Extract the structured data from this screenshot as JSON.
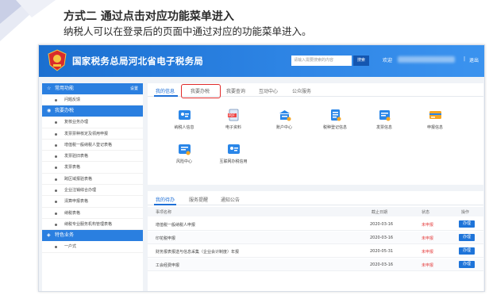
{
  "slide": {
    "title": "方式二 通过点击对应功能菜单进入",
    "subtitle": "纳税人可以在登录后的页面中通过对应的功能菜单进入。"
  },
  "header": {
    "site_title": "国家税务总局河北省电子税务局",
    "search_placeholder": "请输入需要搜索的内容",
    "search_button": "搜索",
    "welcome": "欢迎",
    "separator": "|",
    "logout": "退出"
  },
  "sidebar": {
    "common_title": "常用功能",
    "common_more": "设置",
    "common_items": [
      "问题反馈"
    ],
    "tax_title": "我要办税",
    "tax_items": [
      "复核业务办理",
      "发票票种核定及领用申报",
      "增值税一般纳税人登记表格",
      "发票验旧表格",
      "发票表格",
      "跨区域报验表格",
      "企业注销综合办理",
      "清算申报表格",
      "纳税表格",
      "纳税专业服务机构管理表格"
    ],
    "feature_title": "特色业务",
    "feature_items": [
      "一户式"
    ]
  },
  "main": {
    "tabs": [
      "我的信息",
      "我要办税",
      "我要查询",
      "互动中心",
      "公众服务"
    ],
    "functions": [
      {
        "label": "纳税人信息",
        "icon": "user-info-icon"
      },
      {
        "label": "电子资料",
        "icon": "pdf-document-icon"
      },
      {
        "label": "账户中心",
        "icon": "account-center-icon"
      },
      {
        "label": "税种登记信息",
        "icon": "tax-registration-icon"
      },
      {
        "label": "发票信息",
        "icon": "invoice-info-icon"
      },
      {
        "label": "申报信息",
        "icon": "declaration-info-icon"
      },
      {
        "label": "风险中心",
        "icon": "risk-center-icon"
      },
      {
        "label": "互联网办税信用",
        "icon": "credit-icon"
      }
    ]
  },
  "todo": {
    "tabs": [
      "我的待办",
      "服务提醒",
      "通知公告"
    ],
    "columns": [
      "事项名称",
      "截止日期",
      "状态",
      "操作"
    ],
    "rows": [
      {
        "name": "增值税一般纳税人申报",
        "date": "2020-03-16",
        "status": "未申报",
        "action": "办理"
      },
      {
        "name": "印花税申报",
        "date": "2020-03-16",
        "status": "未申报",
        "action": "办理"
      },
      {
        "name": "财务报表报送与信息采集（企业会计制度）年报",
        "date": "2020-05-31",
        "status": "未申报",
        "action": "办理"
      },
      {
        "name": "工会经费申报",
        "date": "2020-03-16",
        "status": "未申报",
        "action": "办理"
      }
    ]
  },
  "colors": {
    "brand_blue": "#1e6fd6",
    "highlight_red": "#e02a2a",
    "status_red": "#e53b3b"
  }
}
